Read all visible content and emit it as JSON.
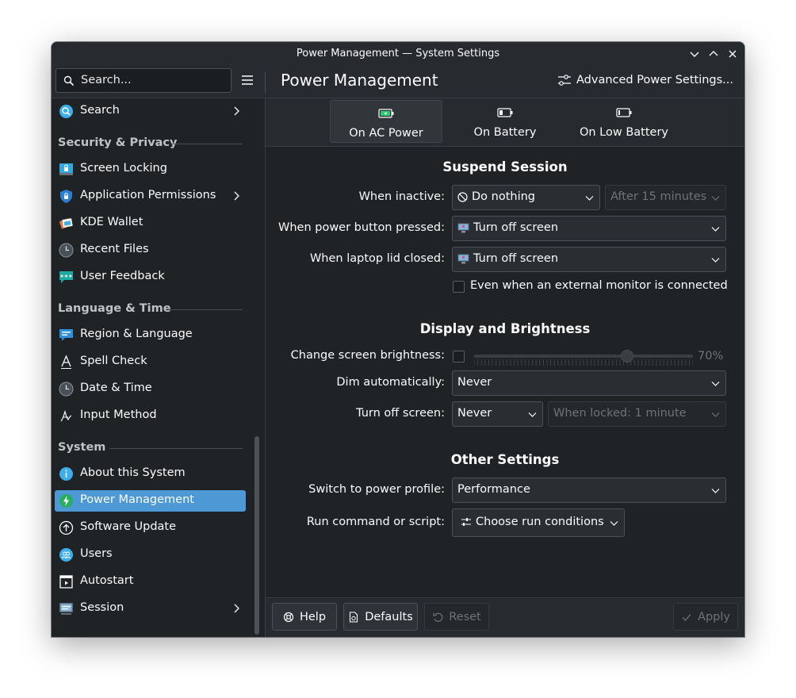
{
  "window": {
    "title": "Power Management — System Settings"
  },
  "toolbar": {
    "search_placeholder": "Search...",
    "page_title": "Power Management",
    "advanced_label": "Advanced Power Settings..."
  },
  "sidebar": {
    "search_item": "Search",
    "sections": [
      {
        "title": "Security & Privacy",
        "items": [
          "Screen Locking",
          "Application Permissions",
          "KDE Wallet",
          "Recent Files",
          "User Feedback"
        ]
      },
      {
        "title": "Language & Time",
        "items": [
          "Region & Language",
          "Spell Check",
          "Date & Time",
          "Input Method"
        ]
      },
      {
        "title": "System",
        "items": [
          "About this System",
          "Power Management",
          "Software Update",
          "Users",
          "Autostart",
          "Session"
        ]
      }
    ],
    "active_item": "Power Management"
  },
  "tabs": [
    "On AC Power",
    "On Battery",
    "On Low Battery"
  ],
  "suspend": {
    "title": "Suspend Session",
    "when_inactive_label": "When inactive:",
    "when_inactive_value": "Do nothing",
    "after_value": "After 15 minutes",
    "power_button_label": "When power button pressed:",
    "power_button_value": "Turn off screen",
    "lid_label": "When laptop lid closed:",
    "lid_value": "Turn off screen",
    "external_monitor_label": "Even when an external monitor is connected",
    "external_monitor_checked": false
  },
  "display": {
    "title": "Display and Brightness",
    "brightness_label": "Change screen brightness:",
    "brightness_checked": false,
    "brightness_value_text": "70%",
    "brightness_level": 0.7,
    "dim_label": "Dim automatically:",
    "dim_value": "Never",
    "turn_off_label": "Turn off screen:",
    "turn_off_value": "Never",
    "when_locked_value": "When locked: 1 minute"
  },
  "other": {
    "title": "Other Settings",
    "profile_label": "Switch to power profile:",
    "profile_value": "Performance",
    "run_label": "Run command or script:",
    "run_button": "Choose run conditions"
  },
  "footer": {
    "help": "Help",
    "defaults": "Defaults",
    "reset": "Reset",
    "apply": "Apply"
  },
  "colors": {
    "accent": "#4d99d6",
    "background": "#202326"
  }
}
